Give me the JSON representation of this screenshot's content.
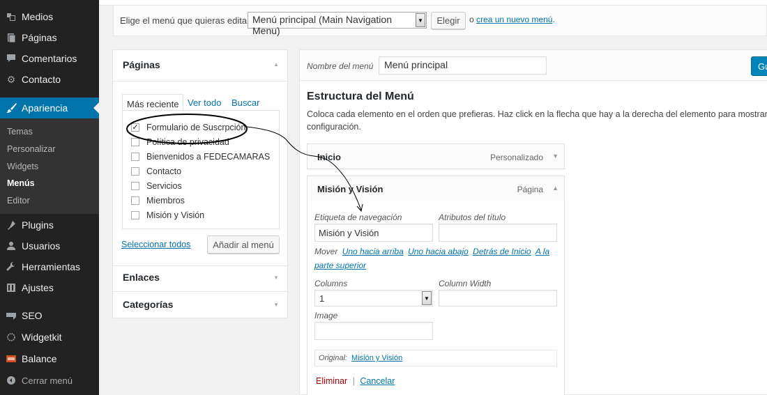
{
  "sidebar": {
    "items": [
      {
        "label": "Medios",
        "icon": "media-icon"
      },
      {
        "label": "Páginas",
        "icon": "pages-icon"
      },
      {
        "label": "Comentarios",
        "icon": "comments-icon"
      },
      {
        "label": "Contacto",
        "icon": "gear-icon"
      },
      {
        "label": "Apariencia",
        "icon": "paintbrush-icon"
      },
      {
        "label": "Plugins",
        "icon": "plugin-icon"
      },
      {
        "label": "Usuarios",
        "icon": "user-icon"
      },
      {
        "label": "Herramientas",
        "icon": "wrench-icon"
      },
      {
        "label": "Ajustes",
        "icon": "settings-icon"
      },
      {
        "label": "SEO",
        "icon": "seo-icon"
      },
      {
        "label": "Widgetkit",
        "icon": "widgetkit-icon"
      },
      {
        "label": "Balance",
        "icon": "balance-icon"
      }
    ],
    "submenu": [
      "Temas",
      "Personalizar",
      "Widgets",
      "Menús",
      "Editor"
    ],
    "collapse_label": "Cerrar menú"
  },
  "manage": {
    "prompt": "Elige el menú que quieras editar:",
    "selected_menu": "Menú principal (Main Navigation Menu)",
    "choose_button": "Elegir",
    "or_text": "o",
    "create_link": "crea un nuevo menú",
    "period": "."
  },
  "accordion": {
    "pages_title": "Páginas",
    "tabs": [
      "Más reciente",
      "Ver todo",
      "Buscar"
    ],
    "pages": [
      {
        "label": "Formulario de Suscrpción",
        "checked": true
      },
      {
        "label": "Política de privacidad",
        "checked": false
      },
      {
        "label": "Bienvenidos a FEDECAMARAS",
        "checked": false
      },
      {
        "label": "Contacto",
        "checked": false
      },
      {
        "label": "Servicios",
        "checked": false
      },
      {
        "label": "Miembros",
        "checked": false
      },
      {
        "label": "Misión y Visión",
        "checked": false
      }
    ],
    "select_all": "Seleccionar todos",
    "add_button": "Añadir al menú",
    "links_title": "Enlaces",
    "categories_title": "Categorías"
  },
  "editor": {
    "menu_name_label": "Nombre del menú",
    "menu_name_value": "Menú principal",
    "save_button_partial": "Gu",
    "structure_title": "Estructura del Menú",
    "structure_desc_line1": "Coloca cada elemento en el orden que prefieras. Haz click en la flecha que hay a la derecha del elemento para mostrar má",
    "structure_desc_line2": "configuración.",
    "items": [
      {
        "title": "Inicio",
        "type": "Personalizado"
      },
      {
        "title": "Misión y Visión",
        "type": "Página"
      }
    ],
    "settings": {
      "nav_label_label": "Etiqueta de navegación",
      "nav_label_value": "Misión y Visión",
      "title_attr_label": "Atributos del título",
      "move_label": "Mover",
      "move_up": "Uno hacia arriba",
      "move_down": "Uno hacia abajo",
      "move_under": "Detrás de Inicio",
      "move_top_a": "A la",
      "move_top_b": "parte superior",
      "columns_label": "Columns",
      "columns_value": "1",
      "column_width_label": "Column Width",
      "image_label": "Image",
      "original_label": "Original:",
      "original_link": "Misión y Visión",
      "delete_link": "Eliminar",
      "separator": "|",
      "cancel_link": "Cancelar"
    }
  },
  "colors": {
    "sidebar_bg": "#222222",
    "active_blue": "#0073aa",
    "link_blue": "#0073aa",
    "delete_red": "#a00000"
  }
}
